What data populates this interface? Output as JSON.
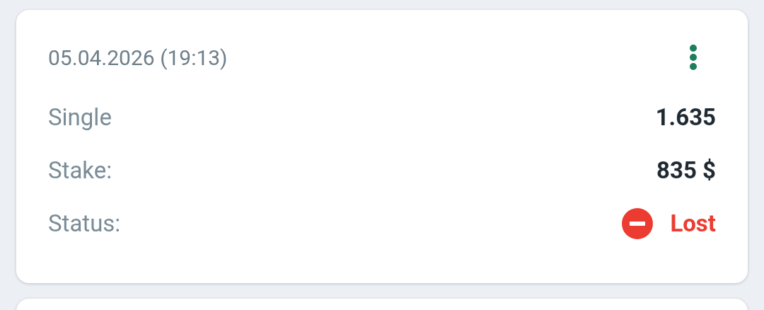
{
  "bet": {
    "date": "05.04.2026 (19:13)",
    "rows": [
      {
        "label": "Single",
        "value": "1.635",
        "kind": "text"
      },
      {
        "label": "Stake:",
        "value": "835 $",
        "kind": "text"
      },
      {
        "label": "Status:",
        "value": "Lost",
        "kind": "lost"
      }
    ]
  }
}
